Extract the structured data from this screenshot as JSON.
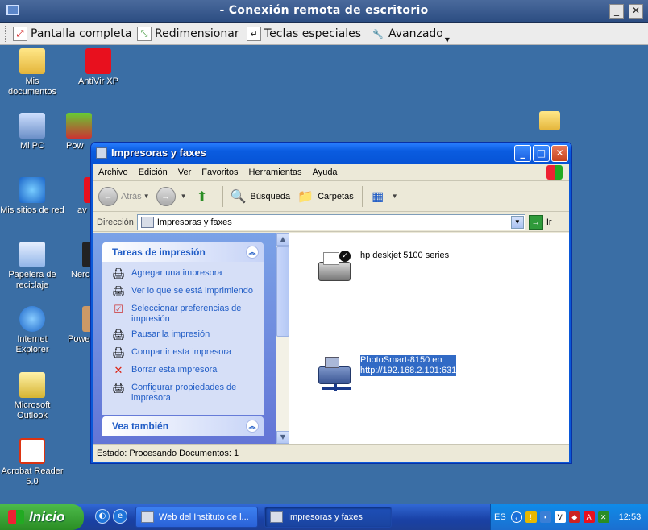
{
  "remote_desktop": {
    "title": "- Conexión remota de escritorio",
    "minimize": "_",
    "maximize": "□",
    "close": "✕",
    "toolbar": {
      "fullscreen": "Pantalla completa",
      "resize": "Redimensionar",
      "special_keys": "Teclas especiales",
      "advanced": "Avanzado"
    }
  },
  "desktop_icons": [
    {
      "label": "Mis documentos",
      "icon": "folder-icon"
    },
    {
      "label": "AntiVir XP",
      "icon": "antivir-icon"
    },
    {
      "label": "Mi PC",
      "icon": "computer-icon"
    },
    {
      "label": "Pow",
      "icon": "media-icon"
    },
    {
      "label": "Mis sitios de red",
      "icon": "network-icon"
    },
    {
      "label": "av",
      "icon": "app-icon"
    },
    {
      "label": "Papelera de reciclaje",
      "icon": "recycle-bin-icon"
    },
    {
      "label": "Nerc",
      "icon": "nero-icon"
    },
    {
      "label": "Internet Explorer",
      "icon": "ie-icon"
    },
    {
      "label": "Powe",
      "icon": "app-icon"
    },
    {
      "label": "Microsoft Outlook",
      "icon": "outlook-icon"
    },
    {
      "label": "Acrobat Reader 5.0",
      "icon": "acrobat-icon"
    }
  ],
  "explorer": {
    "title": "Impresoras y faxes",
    "menu": [
      "Archivo",
      "Edición",
      "Ver",
      "Favoritos",
      "Herramientas",
      "Ayuda"
    ],
    "toolbar": {
      "back": "Atrás",
      "search": "Búsqueda",
      "folders": "Carpetas"
    },
    "address": {
      "label": "Dirección",
      "value": "Impresoras y faxes",
      "go": "Ir"
    },
    "tasks_panel": {
      "title": "Tareas de impresión",
      "items": [
        {
          "label": "Agregar una impresora",
          "icon": "add-printer-icon"
        },
        {
          "label": "Ver lo que se está imprimiendo",
          "icon": "printer-queue-icon"
        },
        {
          "label": "Seleccionar preferencias de impresión",
          "icon": "preferences-icon"
        },
        {
          "label": "Pausar la impresión",
          "icon": "pause-printer-icon"
        },
        {
          "label": "Compartir esta impresora",
          "icon": "share-printer-icon"
        },
        {
          "label": "Borrar esta impresora",
          "icon": "delete-icon"
        },
        {
          "label": "Configurar propiedades de impresora",
          "icon": "properties-icon"
        }
      ]
    },
    "see_also_panel": {
      "title": "Vea también"
    },
    "printers": [
      {
        "name": "hp deskjet 5100 series",
        "default": true,
        "selected": false
      },
      {
        "name_line1": "PhotoSmart-8150 en",
        "name_line2": "http://192.168.2.101:631",
        "network": true,
        "selected": true
      }
    ],
    "status": "Estado: Procesando Documentos: 1"
  },
  "taskbar": {
    "start": "Inicio",
    "tasks": [
      {
        "label": "Web del Instituto de l...",
        "active": false
      },
      {
        "label": "Impresoras y faxes",
        "active": true
      }
    ],
    "tray": {
      "lang": "ES",
      "clock": "12:53"
    }
  },
  "colors": {
    "desktop": "#3a6ea5",
    "xp_blue": "#0a58d8",
    "task_link": "#215dc6",
    "selection": "#316ac5",
    "start_green": "#2a8d24"
  }
}
